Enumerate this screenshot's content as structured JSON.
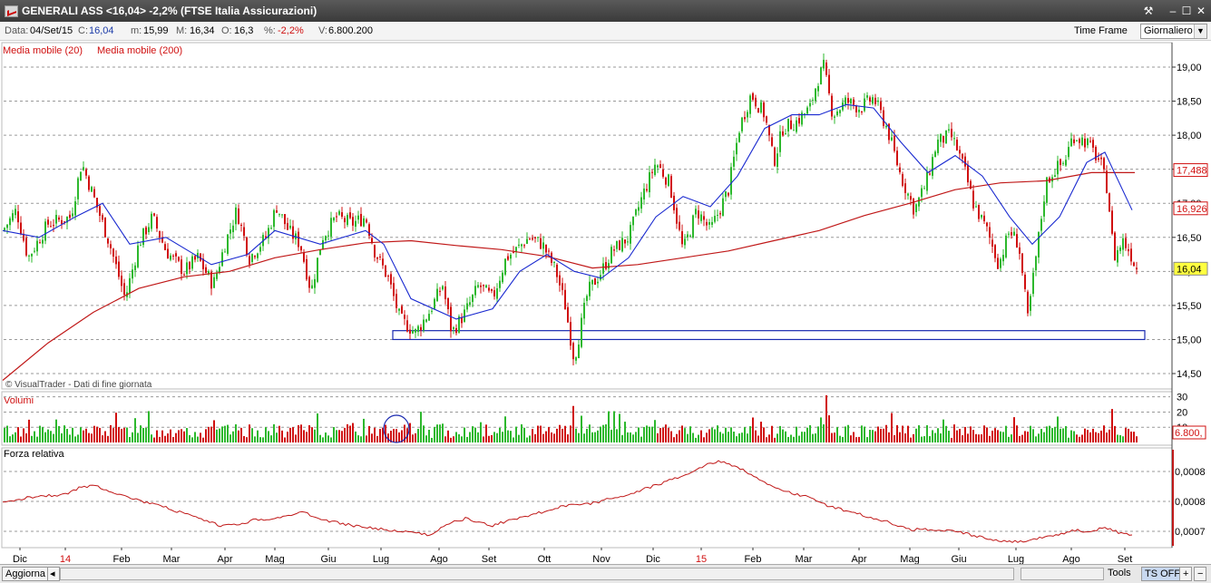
{
  "window": {
    "title": "GENERALI ASS <16,04> -2,2%  (FTSE Italia Assicurazioni)"
  },
  "info": {
    "data_label": "Data:",
    "data_value": "04/Set/15",
    "c_label": "C:",
    "c_value": "16,04",
    "m_label": "m:",
    "m_value": "15,99",
    "M_label": "M:",
    "M_value": "16,34",
    "o_label": "O:",
    "o_value": "16,3",
    "pct_label": "%:",
    "pct_value": "-2,2%",
    "v_label": "V:",
    "v_value": "6.800.200",
    "timeframe_label": "Time Frame",
    "timeframe_value": "Giornaliero"
  },
  "bottom": {
    "update_button": "Aggiorna",
    "tools_label": "Tools",
    "ts_off": "TS OFF"
  },
  "colors": {
    "up": "#2db82d",
    "down": "#d01010",
    "ma20": "#1a2ad0",
    "ma200": "#c01818",
    "support_box": "#1a2ab0",
    "grid": "#9a9a9a",
    "last_price_bg": "#ffff40"
  },
  "chart_data": [
    {
      "type": "candlestick",
      "title": "",
      "legend": [
        "Media mobile (20)",
        "Media mobile (200)"
      ],
      "watermark": "© VisualTrader - Dati di fine giornata",
      "y_ticks": [
        "14,50",
        "15,00",
        "15,50",
        "16,00",
        "16,50",
        "17,00",
        "17,50",
        "18,00",
        "18,50",
        "19,00"
      ],
      "ylim": [
        14.3,
        19.25
      ],
      "x_labels": [
        "Dic",
        "14",
        "Feb",
        "Mar",
        "Apr",
        "Mag",
        "Giu",
        "Lug",
        "Ago",
        "Set",
        "Ott",
        "Nov",
        "Dic",
        "15",
        "Feb",
        "Mar",
        "Apr",
        "Mag",
        "Giu",
        "Lug",
        "Ago",
        "Set"
      ],
      "price_path": [
        [
          0,
          16.6
        ],
        [
          15,
          16.9
        ],
        [
          28,
          16.2
        ],
        [
          50,
          16.7
        ],
        [
          75,
          16.8
        ],
        [
          87,
          17.6
        ],
        [
          100,
          17.1
        ],
        [
          118,
          16.4
        ],
        [
          135,
          15.6
        ],
        [
          150,
          16.4
        ],
        [
          165,
          16.8
        ],
        [
          180,
          16.3
        ],
        [
          200,
          16.0
        ],
        [
          215,
          16.2
        ],
        [
          232,
          15.8
        ],
        [
          245,
          16.4
        ],
        [
          258,
          16.9
        ],
        [
          272,
          16.2
        ],
        [
          290,
          16.5
        ],
        [
          302,
          16.95
        ],
        [
          315,
          16.6
        ],
        [
          328,
          16.4
        ],
        [
          340,
          15.7
        ],
        [
          352,
          16.5
        ],
        [
          368,
          16.8
        ],
        [
          385,
          16.7
        ],
        [
          400,
          16.8
        ],
        [
          410,
          16.3
        ],
        [
          425,
          15.9
        ],
        [
          438,
          15.3
        ],
        [
          455,
          15.1
        ],
        [
          470,
          15.4
        ],
        [
          485,
          15.8
        ],
        [
          495,
          15.1
        ],
        [
          510,
          15.4
        ],
        [
          525,
          15.8
        ],
        [
          540,
          15.6
        ],
        [
          555,
          16.2
        ],
        [
          565,
          16.3
        ],
        [
          580,
          16.5
        ],
        [
          595,
          16.4
        ],
        [
          610,
          16.0
        ],
        [
          620,
          15.5
        ],
        [
          630,
          14.7
        ],
        [
          645,
          15.7
        ],
        [
          660,
          16.0
        ],
        [
          672,
          16.3
        ],
        [
          690,
          16.5
        ],
        [
          705,
          17.1
        ],
        [
          720,
          17.6
        ],
        [
          735,
          17.3
        ],
        [
          750,
          16.3
        ],
        [
          765,
          16.9
        ],
        [
          780,
          16.6
        ],
        [
          800,
          17.2
        ],
        [
          812,
          18.1
        ],
        [
          825,
          18.6
        ],
        [
          840,
          18.3
        ],
        [
          850,
          17.6
        ],
        [
          860,
          18.1
        ],
        [
          875,
          18.2
        ],
        [
          890,
          18.4
        ],
        [
          898,
          18.8
        ],
        [
          905,
          19.0
        ],
        [
          915,
          18.3
        ],
        [
          930,
          18.5
        ],
        [
          945,
          18.4
        ],
        [
          960,
          18.55
        ],
        [
          975,
          18.1
        ],
        [
          990,
          17.4
        ],
        [
          1005,
          16.9
        ],
        [
          1018,
          17.3
        ],
        [
          1030,
          17.9
        ],
        [
          1045,
          18.0
        ],
        [
          1052,
          17.8
        ],
        [
          1060,
          17.5
        ],
        [
          1070,
          17.0
        ],
        [
          1085,
          16.6
        ],
        [
          1098,
          16.1
        ],
        [
          1110,
          16.6
        ],
        [
          1120,
          16.4
        ],
        [
          1130,
          15.3
        ],
        [
          1140,
          16.3
        ],
        [
          1150,
          17.3
        ],
        [
          1160,
          17.5
        ],
        [
          1170,
          17.6
        ],
        [
          1180,
          18.0
        ],
        [
          1195,
          17.9
        ],
        [
          1210,
          17.6
        ],
        [
          1218,
          17.2
        ],
        [
          1225,
          16.2
        ],
        [
          1235,
          16.45
        ],
        [
          1242,
          16.3
        ],
        [
          1250,
          16.04
        ]
      ],
      "ma20_path": [
        [
          0,
          16.6
        ],
        [
          40,
          16.5
        ],
        [
          80,
          16.8
        ],
        [
          110,
          17.0
        ],
        [
          140,
          16.4
        ],
        [
          180,
          16.5
        ],
        [
          230,
          16.1
        ],
        [
          270,
          16.25
        ],
        [
          300,
          16.6
        ],
        [
          350,
          16.4
        ],
        [
          400,
          16.6
        ],
        [
          420,
          16.4
        ],
        [
          450,
          15.6
        ],
        [
          500,
          15.3
        ],
        [
          540,
          15.45
        ],
        [
          570,
          16.0
        ],
        [
          600,
          16.25
        ],
        [
          630,
          16.0
        ],
        [
          660,
          15.9
        ],
        [
          690,
          16.2
        ],
        [
          720,
          16.8
        ],
        [
          750,
          17.1
        ],
        [
          780,
          16.95
        ],
        [
          810,
          17.4
        ],
        [
          840,
          18.1
        ],
        [
          870,
          18.3
        ],
        [
          900,
          18.3
        ],
        [
          930,
          18.45
        ],
        [
          960,
          18.4
        ],
        [
          990,
          17.9
        ],
        [
          1020,
          17.45
        ],
        [
          1050,
          17.7
        ],
        [
          1080,
          17.4
        ],
        [
          1110,
          16.8
        ],
        [
          1135,
          16.4
        ],
        [
          1165,
          16.8
        ],
        [
          1195,
          17.6
        ],
        [
          1215,
          17.75
        ],
        [
          1245,
          16.9
        ]
      ],
      "ma200_path": [
        [
          0,
          14.4
        ],
        [
          50,
          14.95
        ],
        [
          100,
          15.4
        ],
        [
          150,
          15.75
        ],
        [
          200,
          15.92
        ],
        [
          250,
          16.0
        ],
        [
          300,
          16.2
        ],
        [
          350,
          16.32
        ],
        [
          400,
          16.42
        ],
        [
          450,
          16.45
        ],
        [
          500,
          16.38
        ],
        [
          550,
          16.32
        ],
        [
          600,
          16.22
        ],
        [
          650,
          16.05
        ],
        [
          700,
          16.1
        ],
        [
          750,
          16.2
        ],
        [
          800,
          16.3
        ],
        [
          850,
          16.45
        ],
        [
          900,
          16.6
        ],
        [
          950,
          16.82
        ],
        [
          1000,
          17.0
        ],
        [
          1050,
          17.2
        ],
        [
          1100,
          17.3
        ],
        [
          1150,
          17.33
        ],
        [
          1200,
          17.45
        ],
        [
          1248,
          17.45
        ]
      ],
      "support_box": {
        "low": 15.0,
        "high": 15.13
      },
      "price_labels": [
        {
          "text": "17,488",
          "value": 17.488,
          "color": "#d01010",
          "bg": "#ffffff"
        },
        {
          "text": "16,926",
          "value": 16.926,
          "color": "#d01010",
          "bg": "#ffffff"
        },
        {
          "text": "16,04",
          "value": 16.04,
          "color": "#000000",
          "bg": "#ffff40"
        }
      ]
    },
    {
      "type": "bar",
      "title": "Volumi",
      "y_ticks": [
        "30",
        "20",
        "10"
      ],
      "ylim": [
        0,
        32
      ],
      "last_label": "6.800,"
    },
    {
      "type": "line",
      "title": "Forza relativa",
      "y_ticks": [
        "0,0008",
        "0,0008",
        "0,0007"
      ],
      "path": [
        [
          0,
          0.55
        ],
        [
          30,
          0.48
        ],
        [
          70,
          0.45
        ],
        [
          85,
          0.38
        ],
        [
          100,
          0.35
        ],
        [
          120,
          0.42
        ],
        [
          150,
          0.52
        ],
        [
          180,
          0.6
        ],
        [
          210,
          0.7
        ],
        [
          240,
          0.8
        ],
        [
          260,
          0.78
        ],
        [
          280,
          0.73
        ],
        [
          300,
          0.72
        ],
        [
          330,
          0.65
        ],
        [
          360,
          0.75
        ],
        [
          400,
          0.82
        ],
        [
          440,
          0.86
        ],
        [
          470,
          0.9
        ],
        [
          490,
          0.78
        ],
        [
          510,
          0.72
        ],
        [
          540,
          0.8
        ],
        [
          560,
          0.73
        ],
        [
          590,
          0.66
        ],
        [
          620,
          0.58
        ],
        [
          650,
          0.55
        ],
        [
          690,
          0.45
        ],
        [
          720,
          0.35
        ],
        [
          750,
          0.25
        ],
        [
          770,
          0.15
        ],
        [
          790,
          0.08
        ],
        [
          810,
          0.15
        ],
        [
          820,
          0.2
        ],
        [
          835,
          0.3
        ],
        [
          860,
          0.42
        ],
        [
          890,
          0.48
        ],
        [
          910,
          0.58
        ],
        [
          940,
          0.66
        ],
        [
          970,
          0.74
        ],
        [
          1000,
          0.84
        ],
        [
          1030,
          0.84
        ],
        [
          1060,
          0.88
        ],
        [
          1090,
          0.95
        ],
        [
          1110,
          0.98
        ],
        [
          1130,
          0.96
        ],
        [
          1160,
          0.9
        ],
        [
          1180,
          0.85
        ],
        [
          1200,
          0.86
        ],
        [
          1215,
          0.82
        ],
        [
          1230,
          0.87
        ],
        [
          1245,
          0.9
        ]
      ]
    }
  ]
}
